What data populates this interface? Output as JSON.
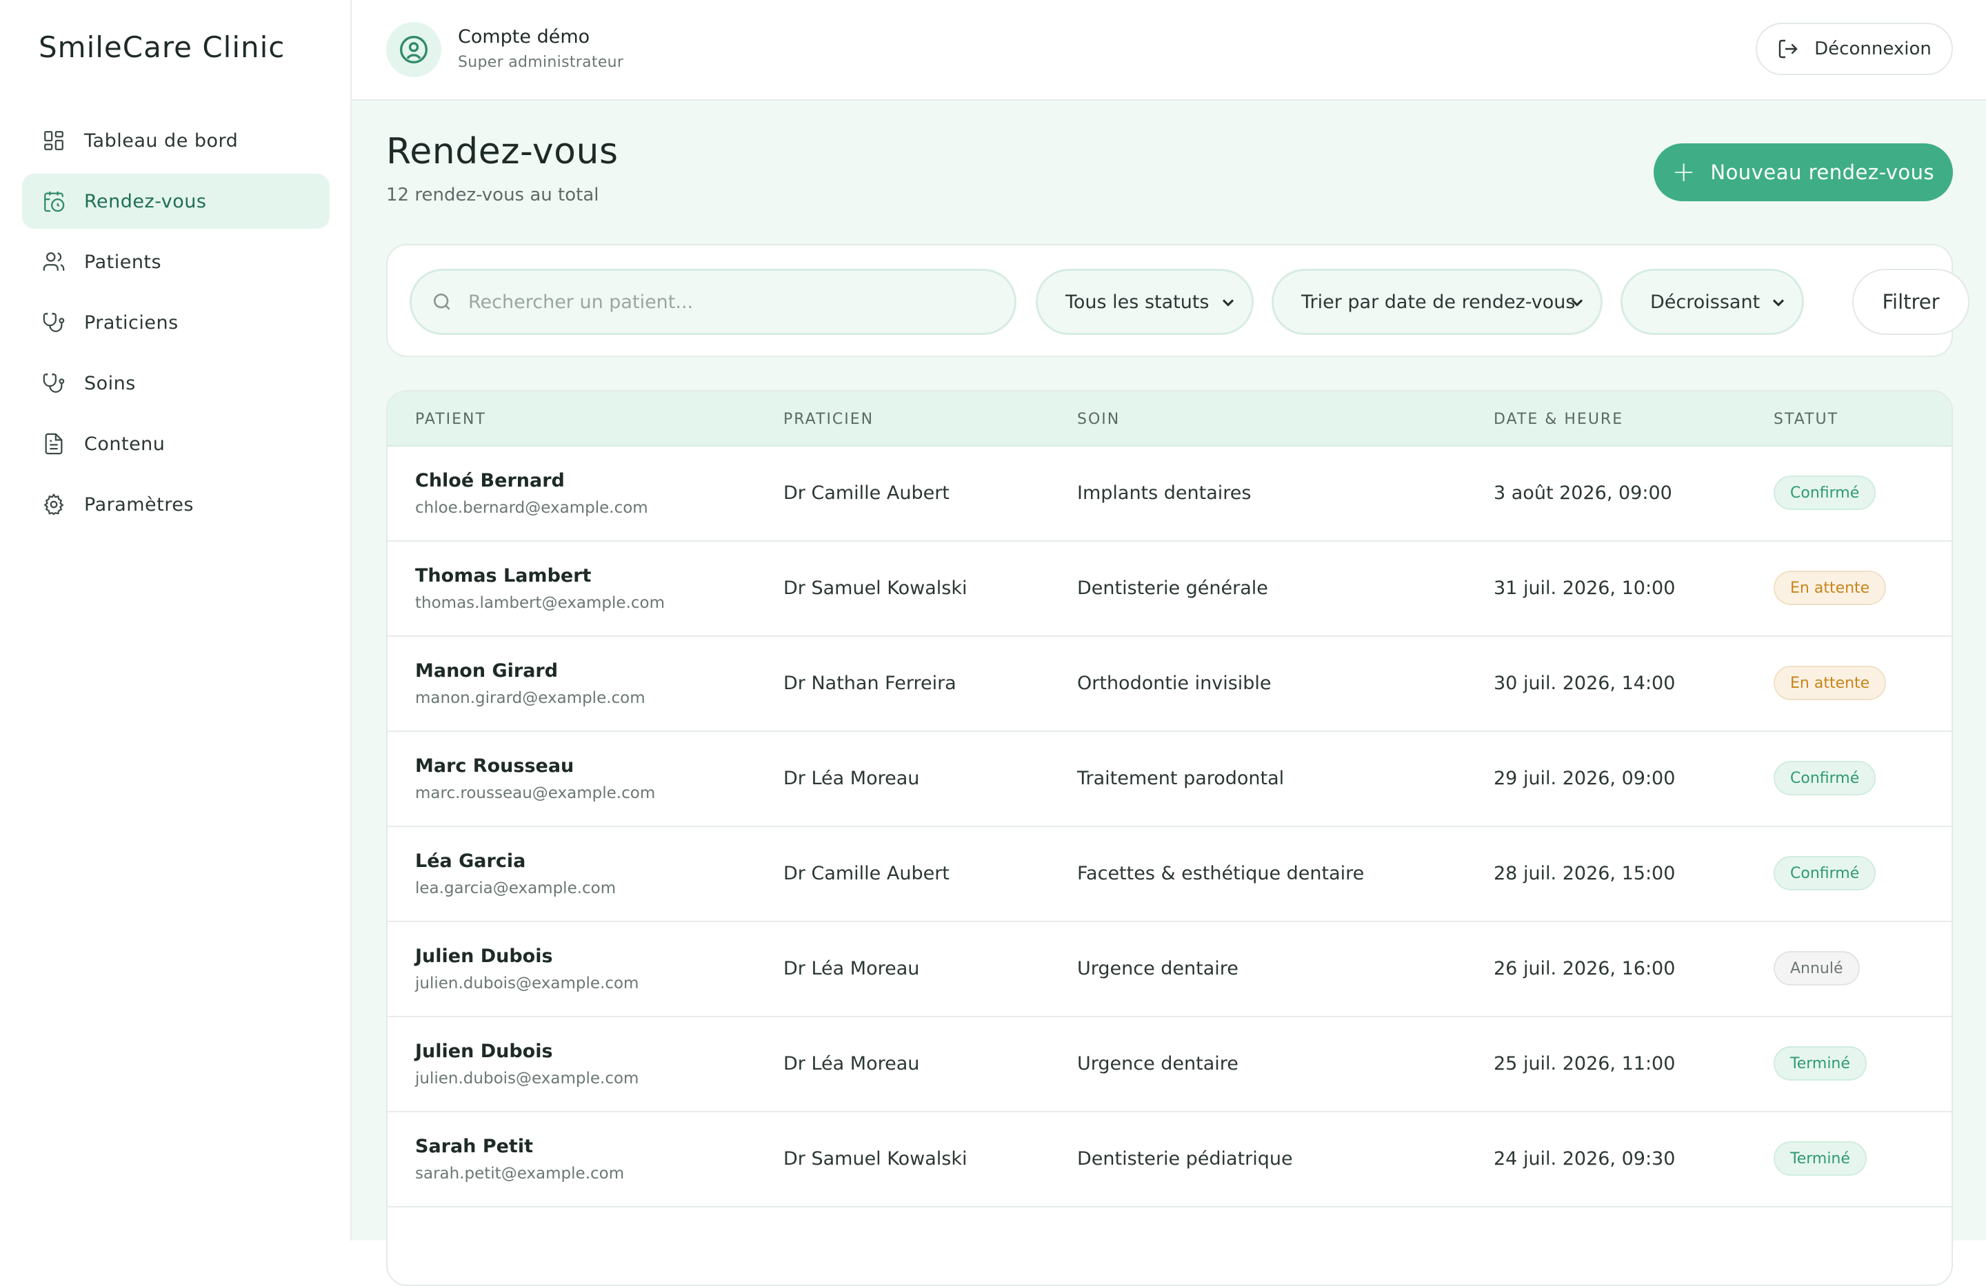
{
  "brand": "SmileCare Clinic",
  "sidebar": {
    "items": [
      {
        "label": "Tableau de bord",
        "icon": "dashboard-icon"
      },
      {
        "label": "Rendez-vous",
        "icon": "calendar-clock-icon",
        "active": true
      },
      {
        "label": "Patients",
        "icon": "users-icon"
      },
      {
        "label": "Praticiens",
        "icon": "stethoscope-icon"
      },
      {
        "label": "Soins",
        "icon": "stethoscope-icon"
      },
      {
        "label": "Contenu",
        "icon": "document-icon"
      },
      {
        "label": "Paramètres",
        "icon": "gear-icon"
      }
    ]
  },
  "header": {
    "account_name": "Compte démo",
    "account_role": "Super administrateur",
    "logout_label": "Déconnexion"
  },
  "main": {
    "title": "Rendez-vous",
    "subtitle": "12 rendez-vous au total",
    "new_button_label": "Nouveau rendez-vous"
  },
  "filters": {
    "search_placeholder": "Rechercher un patient...",
    "status_value": "Tous les statuts",
    "sort_value": "Trier par date de rendez-vous",
    "order_value": "Décroissant",
    "filter_button_label": "Filtrer"
  },
  "table": {
    "columns": [
      "PATIENT",
      "PRATICIEN",
      "SOIN",
      "DATE & HEURE",
      "STATUT"
    ],
    "rows": [
      {
        "name": "Chloé Bernard",
        "email": "chloe.bernard@example.com",
        "praticien": "Dr Camille Aubert",
        "soin": "Implants dentaires",
        "date": "3 août 2026, 09:00",
        "statut": "Confirmé",
        "kind": "ok"
      },
      {
        "name": "Thomas Lambert",
        "email": "thomas.lambert@example.com",
        "praticien": "Dr Samuel Kowalski",
        "soin": "Dentisterie générale",
        "date": "31 juil. 2026, 10:00",
        "statut": "En attente",
        "kind": "wait"
      },
      {
        "name": "Manon Girard",
        "email": "manon.girard@example.com",
        "praticien": "Dr Nathan Ferreira",
        "soin": "Orthodontie invisible",
        "date": "30 juil. 2026, 14:00",
        "statut": "En attente",
        "kind": "wait"
      },
      {
        "name": "Marc Rousseau",
        "email": "marc.rousseau@example.com",
        "praticien": "Dr Léa Moreau",
        "soin": "Traitement parodontal",
        "date": "29 juil. 2026, 09:00",
        "statut": "Confirmé",
        "kind": "ok"
      },
      {
        "name": "Léa Garcia",
        "email": "lea.garcia@example.com",
        "praticien": "Dr Camille Aubert",
        "soin": "Facettes & esthétique dentaire",
        "date": "28 juil. 2026, 15:00",
        "statut": "Confirmé",
        "kind": "ok"
      },
      {
        "name": "Julien Dubois",
        "email": "julien.dubois@example.com",
        "praticien": "Dr Léa Moreau",
        "soin": "Urgence dentaire",
        "date": "26 juil. 2026, 16:00",
        "statut": "Annulé",
        "kind": "cancel"
      },
      {
        "name": "Julien Dubois",
        "email": "julien.dubois@example.com",
        "praticien": "Dr Léa Moreau",
        "soin": "Urgence dentaire",
        "date": "25 juil. 2026, 11:00",
        "statut": "Terminé",
        "kind": "done"
      },
      {
        "name": "Sarah Petit",
        "email": "sarah.petit@example.com",
        "praticien": "Dr Samuel Kowalski",
        "soin": "Dentisterie pédiatrique",
        "date": "24 juil. 2026, 09:30",
        "statut": "Terminé",
        "kind": "done"
      }
    ]
  },
  "colors": {
    "accent": "#3fae86",
    "active_bg": "#e4f5ee",
    "page_bg": "#f1f9f5"
  }
}
